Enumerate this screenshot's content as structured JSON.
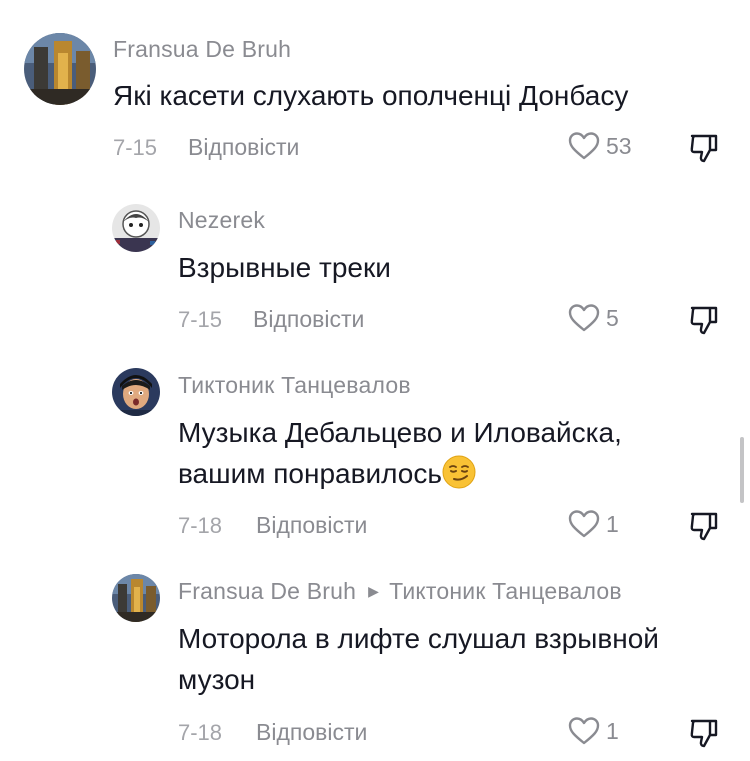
{
  "comments": [
    {
      "author": "Fransua De Bruh",
      "text": "Які касети слухають ополченці Донбасу",
      "date": "7-15",
      "reply_label": "Відповісти",
      "likes": "53"
    },
    {
      "author": "Nezerek",
      "text": "Взрывные треки",
      "date": "7-15",
      "reply_label": "Відповісти",
      "likes": "5"
    },
    {
      "author": "Тиктоник Танцевалов",
      "text_line1": "Музыка Дебальцево и Иловайска,",
      "text_line2": "вашим понравилось",
      "emoji": "smirk-emoji",
      "date": "7-18",
      "reply_label": "Відповісти",
      "likes": "1"
    },
    {
      "author": "Fransua De Bruh",
      "reply_to": "Тиктоник Танцевалов",
      "text_line1": "Моторола в лифте слушал взрывной",
      "text_line2": "музон",
      "date": "7-18",
      "reply_label": "Відповісти",
      "likes": "1"
    }
  ],
  "icons": {
    "like": "heart-outline-icon",
    "dislike": "thumbs-down-icon",
    "reply_arrow": "triangle-right-icon"
  },
  "colors": {
    "text": "#161823",
    "secondary": "#8a8b91",
    "date": "#a4a5aa"
  }
}
